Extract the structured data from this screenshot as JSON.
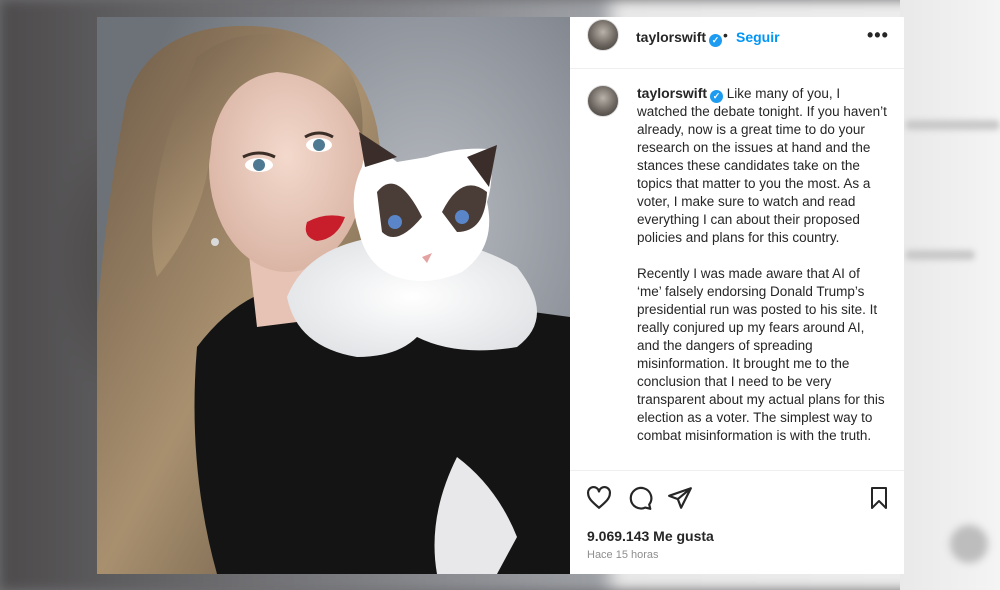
{
  "post": {
    "username": "taylorswift",
    "verified_mark": "✓",
    "separator": "•",
    "follow_label": "Seguir",
    "more_label": "•••",
    "caption_paragraphs": [
      "Like many of you, I watched the debate tonight. If you haven’t already, now is a great time to do your research on the issues at hand and the stances these candidates take on the topics that matter to you the most. As a voter, I make sure to watch and read everything I can about their proposed policies and plans for this country.",
      "Recently I was made aware that AI of ‘me’ falsely endorsing Donald Trump’s presidential run was posted to his site. It really conjured up my fears around AI, and the dangers of spreading misinformation. It brought me to the conclusion that I need to be very transparent about my actual plans for this election as a voter. The simplest way to combat misinformation is with the truth."
    ],
    "likes_text": "9.069.143 Me gusta",
    "time_text": "Hace 15 horas"
  },
  "icons": {
    "like": "heart-icon",
    "comment": "comment-icon",
    "share": "send-icon",
    "save": "bookmark-icon"
  },
  "colors": {
    "follow": "#0095f6",
    "verified": "#1d9bf0",
    "text": "#262626",
    "muted": "#8e8e8e"
  }
}
